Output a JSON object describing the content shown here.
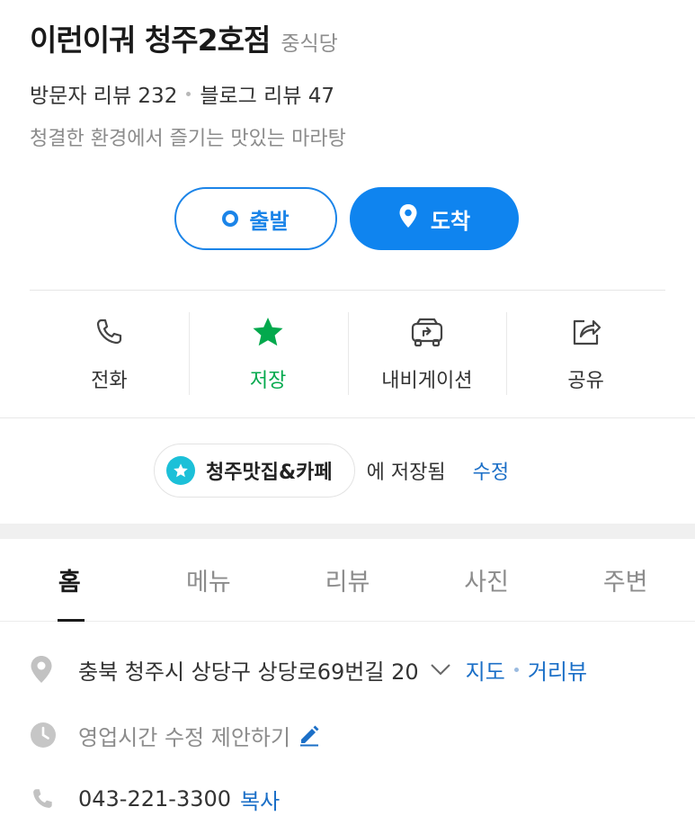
{
  "place": {
    "name": "이런이궈 청주2호점",
    "category": "중식당",
    "visitor_reviews": "방문자 리뷰 232",
    "blog_reviews": "블로그 리뷰 47",
    "description": "청결한 환경에서 즐기는 맛있는 마라탕"
  },
  "route": {
    "depart_label": "출발",
    "arrive_label": "도착"
  },
  "actions": [
    {
      "label": "전화",
      "icon": "phone-icon"
    },
    {
      "label": "저장",
      "icon": "star-icon"
    },
    {
      "label": "내비게이션",
      "icon": "car-navigation-icon"
    },
    {
      "label": "공유",
      "icon": "share-icon"
    }
  ],
  "saved": {
    "folder_name": "청주맛집&카페",
    "saved_text": "에 저장됨",
    "edit_label": "수정"
  },
  "tabs": [
    {
      "label": "홈",
      "active": true
    },
    {
      "label": "메뉴",
      "active": false
    },
    {
      "label": "리뷰",
      "active": false
    },
    {
      "label": "사진",
      "active": false
    },
    {
      "label": "주변",
      "active": false
    }
  ],
  "info": {
    "address": "충북 청주시 상당구 상당로69번길 20",
    "map_label": "지도",
    "roadview_label": "거리뷰",
    "hours_suggest": "영업시간 수정 제안하기",
    "phone": "043-221-3300",
    "copy_label": "복사"
  },
  "colors": {
    "accent_blue": "#0f84ef",
    "saved_green": "#03a94d",
    "chip_cyan": "#1cc0d8",
    "link_blue": "#1b6fc7"
  }
}
